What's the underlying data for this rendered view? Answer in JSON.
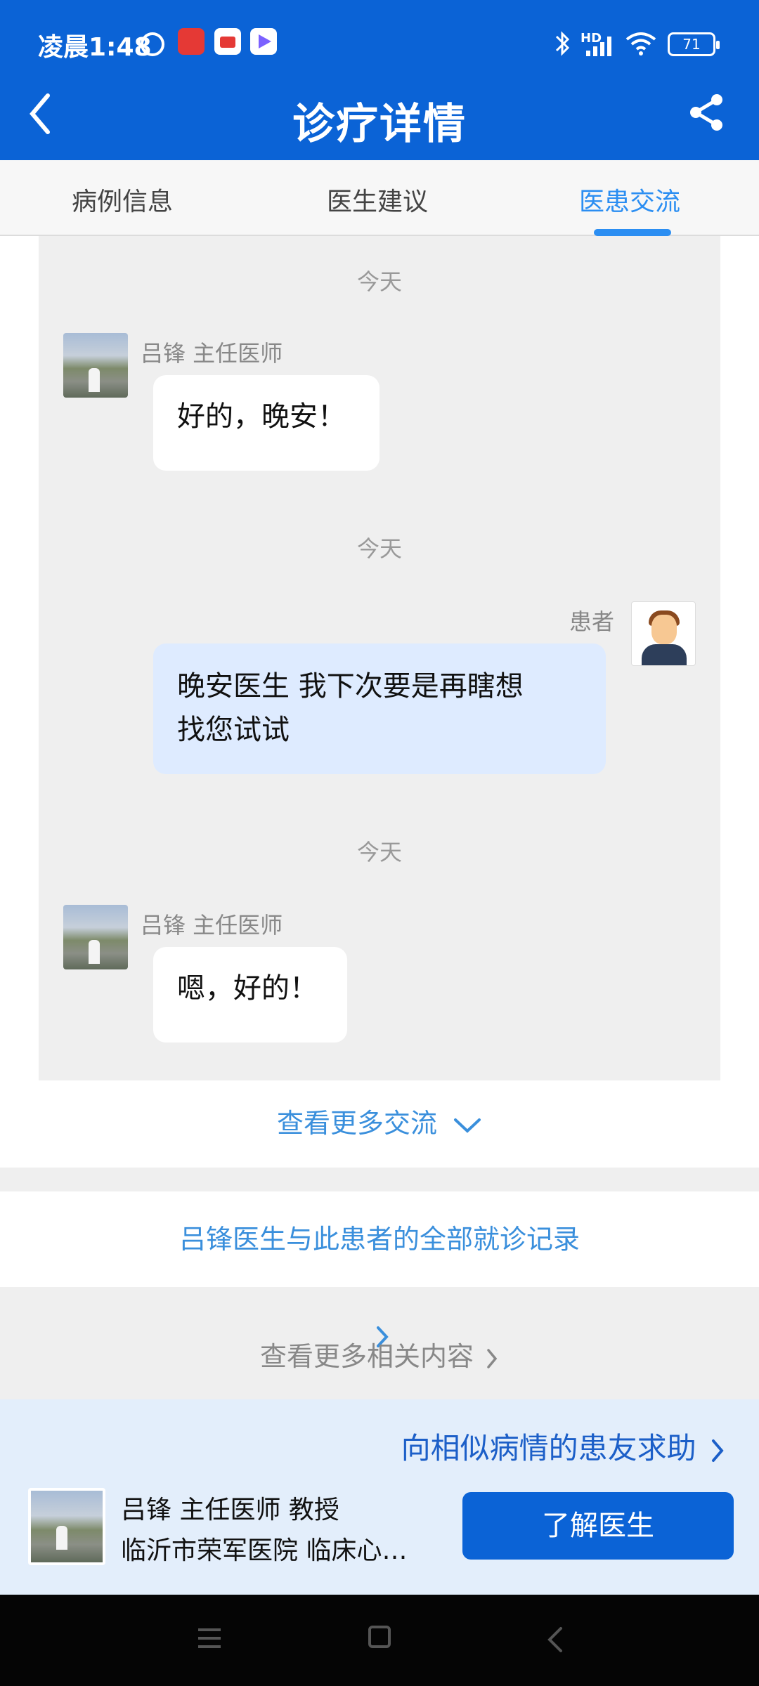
{
  "status": {
    "time": "凌晨1:48",
    "network": "HD",
    "battery": "71",
    "icons": [
      "alarm-icon",
      "app-notification-icon",
      "app-notification-icon",
      "play-store-icon",
      "bluetooth-icon",
      "signal-icon",
      "wifi-icon",
      "battery-icon"
    ]
  },
  "header": {
    "title": "诊疗详情",
    "back_icon": "chevron-left-icon",
    "share_icon": "share-icon"
  },
  "tabs": [
    {
      "label": "病例信息",
      "active": false
    },
    {
      "label": "医生建议",
      "active": false
    },
    {
      "label": "医患交流",
      "active": true
    }
  ],
  "chat": {
    "messages": [
      {
        "day": "今天",
        "sender": "吕锋 主任医师",
        "role": "doctor",
        "text": "好的，晚安！"
      },
      {
        "day": "今天",
        "sender": "患者",
        "role": "patient",
        "text_line1": "晚安医生 我下次要是再瞎想",
        "text_line2": "找您试试"
      },
      {
        "day": "今天",
        "sender": "吕锋 主任医师",
        "role": "doctor",
        "text": "嗯，好的！"
      }
    ]
  },
  "more_link": "查看更多交流",
  "records_link": "吕锋医生与此患者的全部就诊记录",
  "related_link": "查看更多相关内容",
  "bottom": {
    "help_link": "向相似病情的患友求助",
    "doctor_line": "吕锋 主任医师 教授",
    "hospital_line": "临沂市荣军医院 临床心…",
    "button": "了解医生"
  },
  "colors": {
    "brand_blue": "#0b63d6",
    "link_blue": "#3a8fdc",
    "active_tab": "#2b8ef2",
    "patient_bubble": "#deebff"
  }
}
